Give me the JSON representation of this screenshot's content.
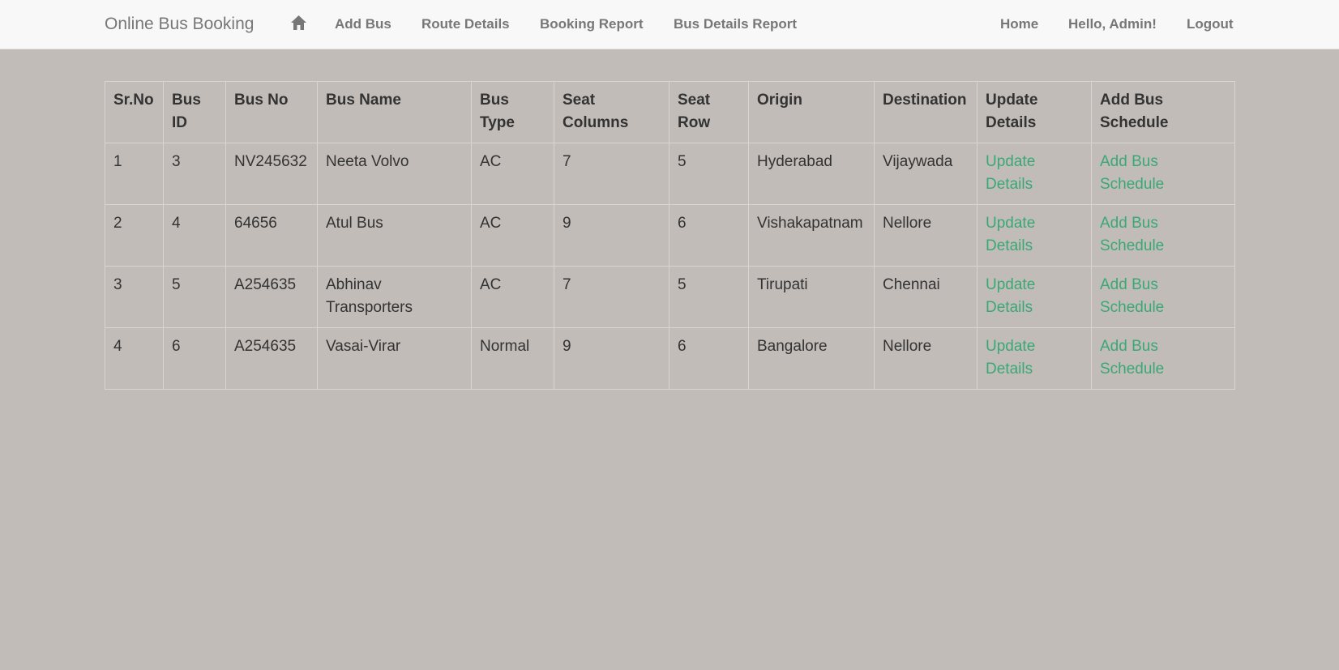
{
  "navbar": {
    "brand": "Online Bus Booking",
    "home_icon": "home-icon",
    "left_items": [
      "Add Bus",
      "Route Details",
      "Booking Report",
      "Bus Details Report"
    ],
    "right_items": [
      "Home",
      "Hello, Admin!",
      "Logout"
    ]
  },
  "table": {
    "headers": [
      "Sr.No",
      "Bus ID",
      "Bus No",
      "Bus Name",
      "Bus Type",
      "Seat Columns",
      "Seat Row",
      "Origin",
      "Destination",
      "Update Details",
      "Add Bus Schedule"
    ],
    "rows": [
      [
        "1",
        "3",
        "NV245632",
        "Neeta Volvo",
        "AC",
        "7",
        "5",
        "Hyderabad",
        "Vijaywada",
        "Update Details",
        "Add Bus Schedule"
      ],
      [
        "2",
        "4",
        "64656",
        "Atul Bus",
        "AC",
        "9",
        "6",
        "Vishakapatnam",
        "Nellore",
        "Update Details",
        "Add Bus Schedule"
      ],
      [
        "3",
        "5",
        "A254635",
        "Abhinav Transporters",
        "AC",
        "7",
        "5",
        "Tirupati",
        "Chennai",
        "Update Details",
        "Add Bus Schedule"
      ],
      [
        "4",
        "6",
        "A254635",
        "Vasai-Virar",
        "Normal",
        "9",
        "6",
        "Bangalore",
        "Nellore",
        "Update Details",
        "Add Bus Schedule"
      ]
    ]
  },
  "colors": {
    "page_background": "#c1bcb8",
    "navbar_background": "#f8f8f8",
    "nav_text": "#777777",
    "link": "#3aa876"
  }
}
